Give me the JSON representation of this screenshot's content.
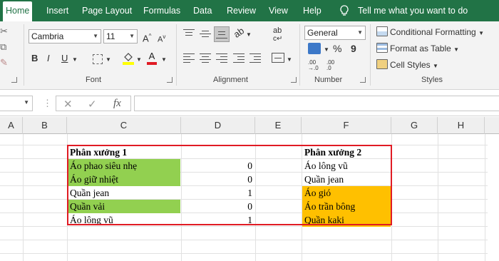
{
  "menu": {
    "tabs": [
      "Home",
      "Insert",
      "Page Layout",
      "Formulas",
      "Data",
      "Review",
      "View",
      "Help"
    ],
    "tell_me": "Tell me what you want to do",
    "active_tab": "Home"
  },
  "ribbon": {
    "font_name": "Cambria",
    "font_size": "11",
    "font_group_label": "Font",
    "alignment_group_label": "Alignment",
    "number_format": "General",
    "number_group_label": "Number",
    "percent_symbol": "%",
    "comma_symbol": "9",
    "dec_inc": ".00\n→.0",
    "dec_dec": ".00\n.0",
    "conditional_formatting": "Conditional Formatting",
    "format_as_table": "Format as Table",
    "cell_styles": "Cell Styles",
    "styles_group_label": "Styles",
    "grow_font": "A",
    "shrink_font": "A",
    "bold": "B",
    "italic": "I",
    "underline": "U",
    "font_color_letter": "A",
    "wrap_icon_text": "ab",
    "accent_colors": {
      "ribbon_green": "#217346",
      "highlight_yellow": "#ffff00",
      "font_red": "#e01b24"
    }
  },
  "formula_bar": {
    "fx_label": "fx",
    "cancel_symbol": "✕",
    "enter_symbol": "✓",
    "formula_value": ""
  },
  "columns": [
    "A",
    "B",
    "C",
    "D",
    "E",
    "F",
    "G",
    "H"
  ],
  "sheet": {
    "c_header": "Phân xưởng 1",
    "f_header": "Phân xưởng 2",
    "rows": [
      {
        "c": "Áo phao siêu nhẹ",
        "d": "0",
        "f": "Áo lông vũ",
        "c_fill": "green",
        "f_fill": ""
      },
      {
        "c": "Áo giữ nhiệt",
        "d": "0",
        "f": "Quần jean",
        "c_fill": "green",
        "f_fill": ""
      },
      {
        "c": "Quần jean",
        "d": "1",
        "f": "Áo gió",
        "c_fill": "",
        "f_fill": "orange"
      },
      {
        "c": "Quần vải",
        "d": "0",
        "f": "Áo trần bông",
        "c_fill": "green",
        "f_fill": "orange"
      },
      {
        "c": "Áo lông vũ",
        "d": "1",
        "f": "Quần kaki",
        "c_fill": "",
        "f_fill": "orange"
      }
    ],
    "fill_colors": {
      "green": "#92d050",
      "orange": "#ffc000",
      "outline": "#e01b24"
    }
  }
}
